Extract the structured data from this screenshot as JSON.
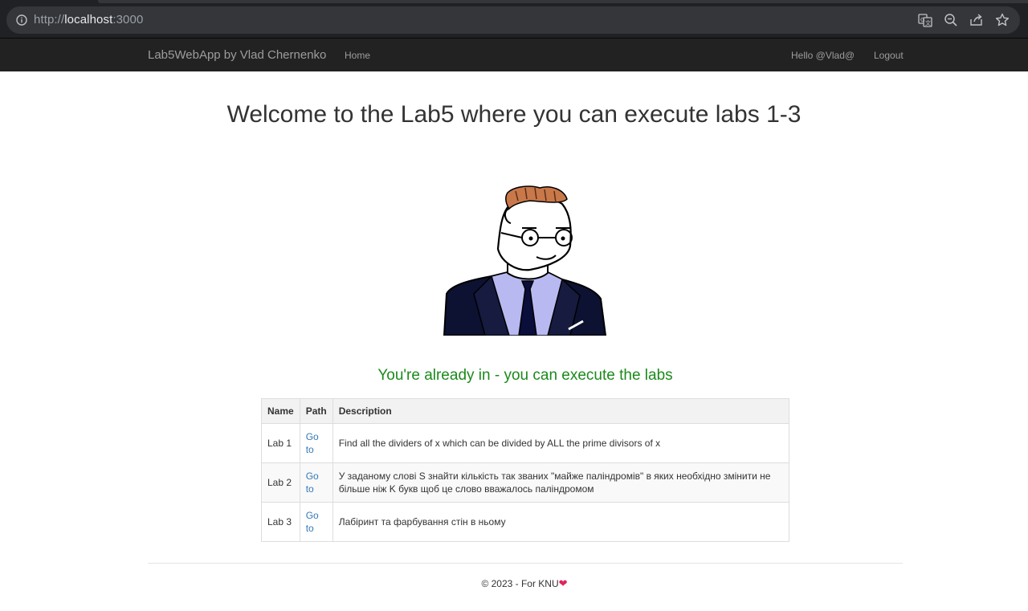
{
  "browser": {
    "url_scheme": "http://",
    "url_host": "localhost",
    "url_port": ":3000"
  },
  "navbar": {
    "brand": "Lab5WebApp by Vlad Chernenko",
    "home": "Home",
    "hello": "Hello @Vlad@!",
    "logout": "Logout"
  },
  "main": {
    "title": "Welcome to the Lab5 where you can execute labs 1-3",
    "status": "You're already in - you can execute the labs"
  },
  "table": {
    "headers": [
      "Name",
      "Path",
      "Description"
    ],
    "rows": [
      {
        "name": "Lab 1",
        "path": "Go to",
        "description": "Find all the dividers of x which can be divided by ALL the prime divisors of x"
      },
      {
        "name": "Lab 2",
        "path": "Go to",
        "description": "У заданому слові S знайти кількість так званих \"майже паліндромів\" в яких необхідно змінити не більше ніж K букв щоб це слово вважалось паліндромом"
      },
      {
        "name": "Lab 3",
        "path": "Go to",
        "description": "Лабіринт та фарбування стін в ньому"
      }
    ]
  },
  "footer": {
    "text": "© 2023 - For KNU",
    "icon": "heart-icon"
  },
  "colors": {
    "navbar_bg": "#222222",
    "status_green": "#1b8a1b",
    "link_blue": "#337ab7",
    "heart_red": "#e0245e"
  }
}
